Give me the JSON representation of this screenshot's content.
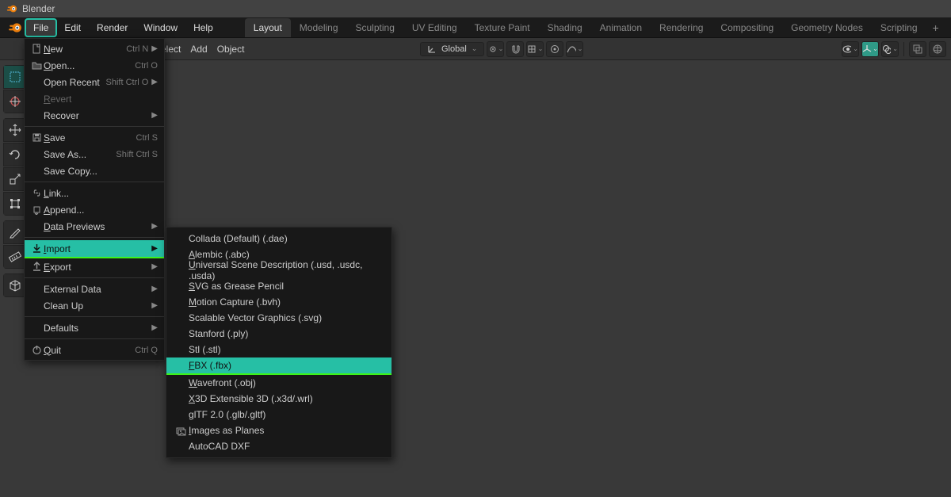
{
  "app": {
    "title": "Blender"
  },
  "menubar": {
    "file": "File",
    "edit": "Edit",
    "render": "Render",
    "window": "Window",
    "help": "Help"
  },
  "workspaces": {
    "tabs": [
      "Layout",
      "Modeling",
      "Sculpting",
      "UV Editing",
      "Texture Paint",
      "Shading",
      "Animation",
      "Rendering",
      "Compositing",
      "Geometry Nodes",
      "Scripting"
    ],
    "active": "Layout"
  },
  "header2": {
    "select": "elect",
    "add": "Add",
    "object": "Object",
    "orientation_label": "Global"
  },
  "file_menu": {
    "items": [
      {
        "kind": "item",
        "icon": "file-icon",
        "label": "New",
        "shortcut": "Ctrl N",
        "arrow": true,
        "ul": "N"
      },
      {
        "kind": "item",
        "icon": "folder-icon",
        "label": "Open...",
        "shortcut": "Ctrl O",
        "ul": "O"
      },
      {
        "kind": "item",
        "label": "Open Recent",
        "shortcut": "Shift Ctrl O",
        "arrow": true
      },
      {
        "kind": "item",
        "label": "Revert",
        "disabled": true,
        "ul": "R"
      },
      {
        "kind": "item",
        "label": "Recover",
        "arrow": true
      },
      {
        "kind": "sep"
      },
      {
        "kind": "item",
        "icon": "save-icon",
        "label": "Save",
        "shortcut": "Ctrl S",
        "ul": "S"
      },
      {
        "kind": "item",
        "label": "Save As...",
        "shortcut": "Shift Ctrl S"
      },
      {
        "kind": "item",
        "label": "Save Copy..."
      },
      {
        "kind": "sep"
      },
      {
        "kind": "item",
        "icon": "link-icon",
        "label": "Link...",
        "ul": "L"
      },
      {
        "kind": "item",
        "icon": "append-icon",
        "label": "Append...",
        "ul": "A"
      },
      {
        "kind": "item",
        "label": "Data Previews",
        "arrow": true,
        "ul": "D"
      },
      {
        "kind": "sep"
      },
      {
        "kind": "item",
        "icon": "import-icon",
        "label": "Import",
        "arrow": true,
        "highlight": true,
        "underline": true,
        "ul": "I"
      },
      {
        "kind": "item",
        "icon": "export-icon",
        "label": "Export",
        "arrow": true,
        "ul": "E"
      },
      {
        "kind": "sep"
      },
      {
        "kind": "item",
        "label": "External Data",
        "arrow": true
      },
      {
        "kind": "item",
        "label": "Clean Up",
        "arrow": true
      },
      {
        "kind": "sep"
      },
      {
        "kind": "item",
        "label": "Defaults",
        "arrow": true
      },
      {
        "kind": "sep"
      },
      {
        "kind": "item",
        "icon": "power-icon",
        "label": "Quit",
        "shortcut": "Ctrl Q",
        "ul": "Q"
      }
    ]
  },
  "import_submenu": {
    "items": [
      {
        "label": "Collada (Default) (.dae)"
      },
      {
        "label": "Alembic (.abc)",
        "ul": "A"
      },
      {
        "label": "Universal Scene Description (.usd, .usdc, .usda)",
        "ul": "U"
      },
      {
        "label": "SVG as Grease Pencil",
        "ul": "S"
      },
      {
        "label": "Motion Capture (.bvh)",
        "ul": "M"
      },
      {
        "label": "Scalable Vector Graphics (.svg)"
      },
      {
        "label": "Stanford (.ply)"
      },
      {
        "label": "Stl (.stl)"
      },
      {
        "label": "FBX (.fbx)",
        "highlight": true,
        "underline": true,
        "ul": "F"
      },
      {
        "label": "Wavefront (.obj)",
        "ul": "W"
      },
      {
        "label": "X3D Extensible 3D (.x3d/.wrl)",
        "ul": "X"
      },
      {
        "label": "glTF 2.0 (.glb/.gltf)",
        "ul": "g"
      },
      {
        "label": "Images as Planes",
        "icon": "images-icon",
        "ul": "I"
      },
      {
        "label": "AutoCAD DXF"
      }
    ]
  }
}
